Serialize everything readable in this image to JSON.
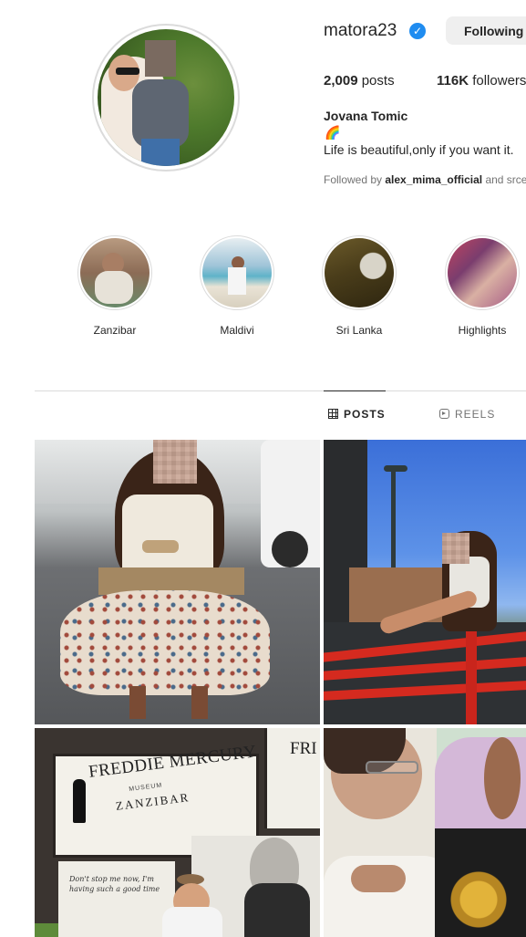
{
  "profile": {
    "username": "matora23",
    "verified_icon": "verified-badge-icon",
    "follow_button": "Following",
    "stats": [
      {
        "count": "2,009",
        "label": "posts"
      },
      {
        "count": "116K",
        "label": "followers"
      }
    ],
    "full_name": "Jovana Tomic",
    "bio_emoji": "🌈",
    "bio": "Life is beautiful,only if you want it.",
    "followed_by_prefix": "Followed by",
    "followed_by_account": "alex_mima_official",
    "followed_by_suffix": "and srce"
  },
  "highlights": [
    {
      "label": "Zanzibar"
    },
    {
      "label": "Maldivi"
    },
    {
      "label": "Sri Lanka"
    },
    {
      "label": "Highlights"
    }
  ],
  "tabs": {
    "posts": "POSTS",
    "reels": "REELS",
    "active": "posts"
  },
  "posts": {
    "post3_sign_title": "FREDDIE MERCURY",
    "post3_sign_subtitle": "MUSEUM",
    "post3_sign_place": "ZANZIBAR",
    "post3_second_sign": "FRI",
    "post3_note": "Don't stop me now, I'm having such a good time"
  },
  "colors": {
    "verified": "#1f8cf0",
    "button_bg": "#efefef",
    "divider": "#dbdbdb",
    "muted_text": "#737373"
  }
}
